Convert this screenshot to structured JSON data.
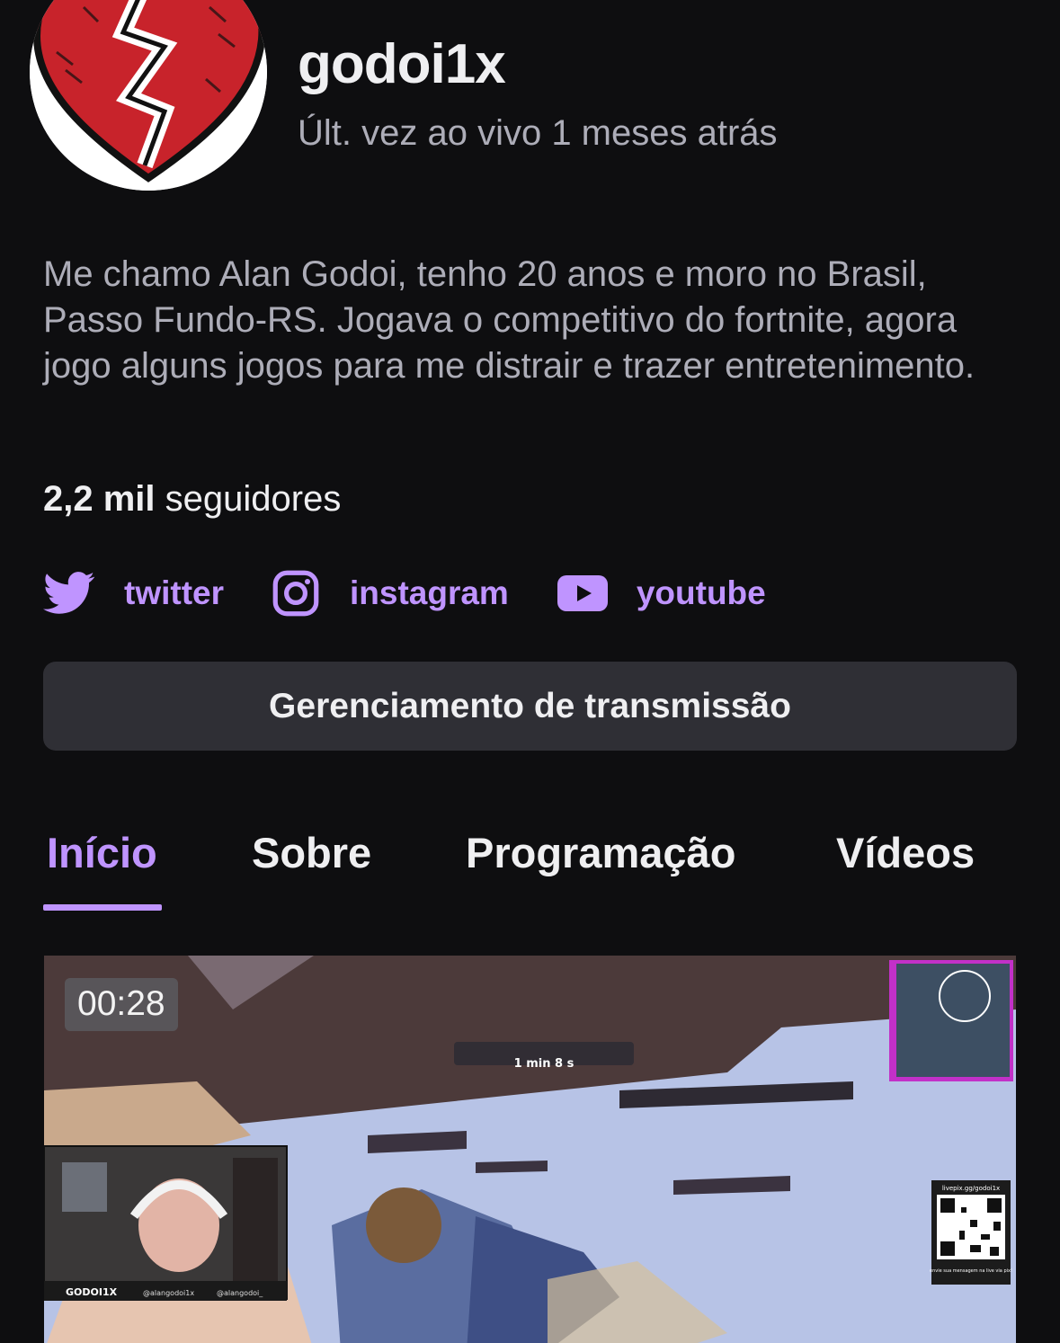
{
  "profile": {
    "channel_name": "godoi1x",
    "last_live": "Últ. vez ao vivo 1 meses atrás",
    "bio": "Me chamo Alan Godoi, tenho 20 anos e moro no Brasil, Passo Fundo-RS. Jogava o competitivo do fortnite, agora jogo alguns jogos para me distrair e trazer entretenimento.",
    "followers_count": "2,2 mil",
    "followers_label": "seguidores"
  },
  "socials": [
    {
      "label": "twitter",
      "icon": "twitter-bird-icon"
    },
    {
      "label": "instagram",
      "icon": "instagram-icon"
    },
    {
      "label": "youtube",
      "icon": "youtube-icon"
    }
  ],
  "manage_button": {
    "label": "Gerenciamento de transmissão"
  },
  "tabs": [
    {
      "label": "Início",
      "active": true
    },
    {
      "label": "Sobre",
      "active": false
    },
    {
      "label": "Programação",
      "active": false
    },
    {
      "label": "Vídeos",
      "active": false
    }
  ],
  "video": {
    "duration": "00:28",
    "overlay_brand": "GODOI1X",
    "overlay_twitter": "@alangodoi1x",
    "overlay_instagram": "@alangodoi_",
    "overlay_timer": "1 min 8 s",
    "overlay_qr_url": "livepix.gg/godoi1x",
    "overlay_qr_caption": "envie sua mensagem na live via pix!"
  },
  "colors": {
    "background": "#0e0e10",
    "accent": "#bf94ff",
    "button_bg": "#2f2f35",
    "secondary_text": "#adadb8"
  }
}
